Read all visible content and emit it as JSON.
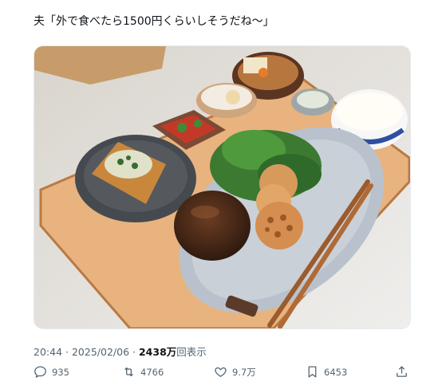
{
  "tweet": {
    "text": "夫「外で食べたら1500円くらいしそうだね〜」"
  },
  "meta": {
    "time": "20:44",
    "separator": "·",
    "date": "2025/02/06",
    "views_count": "2438万",
    "views_label": "回表示"
  },
  "actions": {
    "replies": "935",
    "retweets": "4766",
    "likes": "9.7万",
    "bookmarks": "6453"
  },
  "photo": {
    "icons": [
      "reply-icon",
      "retweet-icon",
      "heart-icon",
      "bookmark-icon",
      "share-icon"
    ],
    "colors": {
      "text": "#0f1419",
      "secondary": "#536471"
    }
  }
}
